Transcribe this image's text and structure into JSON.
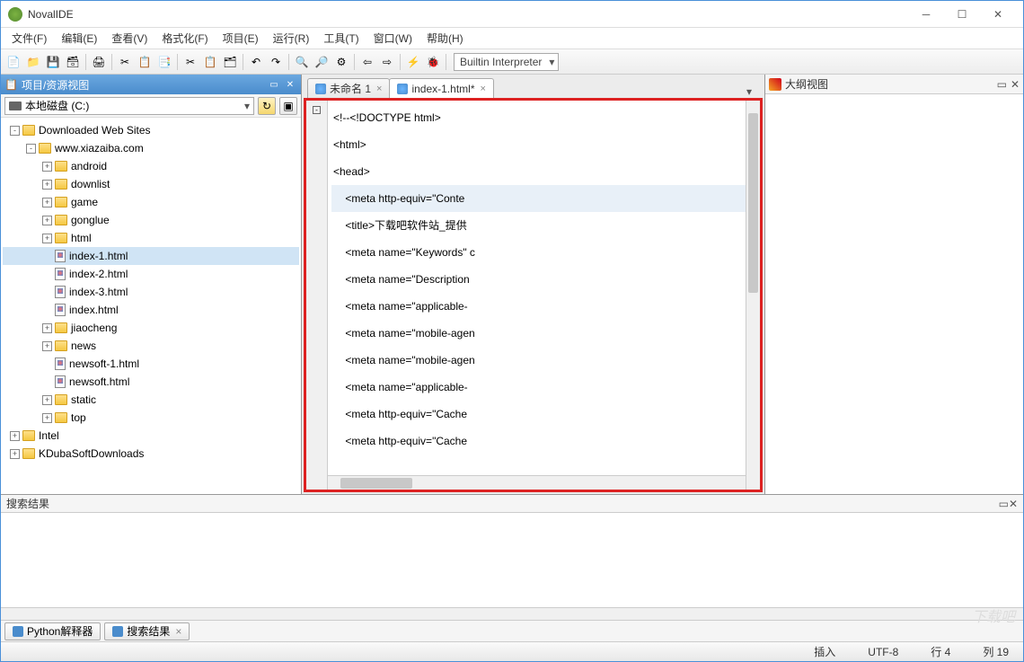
{
  "window": {
    "title": "NovalIDE"
  },
  "menus": [
    "文件(F)",
    "编辑(E)",
    "查看(V)",
    "格式化(F)",
    "项目(E)",
    "运行(R)",
    "工具(T)",
    "窗口(W)",
    "帮助(H)"
  ],
  "interpreter": "Builtin Interpreter",
  "leftPanel": {
    "title": "项目/资源视图",
    "drive": "本地磁盘 (C:)"
  },
  "tree": [
    {
      "indent": 0,
      "exp": "-",
      "icon": "fld",
      "label": "Downloaded Web Sites"
    },
    {
      "indent": 1,
      "exp": "-",
      "icon": "fld",
      "label": "www.xiazaiba.com"
    },
    {
      "indent": 2,
      "exp": "+",
      "icon": "fld",
      "label": "android"
    },
    {
      "indent": 2,
      "exp": "+",
      "icon": "fld",
      "label": "downlist"
    },
    {
      "indent": 2,
      "exp": "+",
      "icon": "fld",
      "label": "game"
    },
    {
      "indent": 2,
      "exp": "+",
      "icon": "fld",
      "label": "gonglue"
    },
    {
      "indent": 2,
      "exp": "+",
      "icon": "fld",
      "label": "html"
    },
    {
      "indent": 2,
      "exp": " ",
      "icon": "fil",
      "label": "index-1.html",
      "sel": true
    },
    {
      "indent": 2,
      "exp": " ",
      "icon": "fil",
      "label": "index-2.html"
    },
    {
      "indent": 2,
      "exp": " ",
      "icon": "fil",
      "label": "index-3.html"
    },
    {
      "indent": 2,
      "exp": " ",
      "icon": "fil",
      "label": "index.html"
    },
    {
      "indent": 2,
      "exp": "+",
      "icon": "fld",
      "label": "jiaocheng"
    },
    {
      "indent": 2,
      "exp": "+",
      "icon": "fld",
      "label": "news"
    },
    {
      "indent": 2,
      "exp": " ",
      "icon": "fil",
      "label": "newsoft-1.html"
    },
    {
      "indent": 2,
      "exp": " ",
      "icon": "fil",
      "label": "newsoft.html"
    },
    {
      "indent": 2,
      "exp": "+",
      "icon": "fld",
      "label": "static"
    },
    {
      "indent": 2,
      "exp": "+",
      "icon": "fld",
      "label": "top"
    },
    {
      "indent": 0,
      "exp": "+",
      "icon": "fld",
      "label": "Intel"
    },
    {
      "indent": 0,
      "exp": "+",
      "icon": "fld",
      "label": "KDubaSoftDownloads"
    }
  ],
  "tabs": [
    {
      "label": "未命名 1",
      "active": false
    },
    {
      "label": "index-1.html*",
      "active": true
    }
  ],
  "code": [
    {
      "text": "<!--<!DOCTYPE html>",
      "hl": false
    },
    {
      "text": "<html>",
      "hl": false
    },
    {
      "text": "<head>",
      "hl": false
    },
    {
      "text": "    <meta http-equiv=\"Conte",
      "hl": true
    },
    {
      "text": "    <title>下载吧软件站_提供",
      "hl": false
    },
    {
      "text": "    <meta name=\"Keywords\" c",
      "hl": false
    },
    {
      "text": "    <meta name=\"Description",
      "hl": false
    },
    {
      "text": "    <meta name=\"applicable-",
      "hl": false
    },
    {
      "text": "    <meta name=\"mobile-agen",
      "hl": false
    },
    {
      "text": "    <meta name=\"mobile-agen",
      "hl": false
    },
    {
      "text": "    <meta name=\"applicable-",
      "hl": false
    },
    {
      "text": "    <meta http-equiv=\"Cache",
      "hl": false
    },
    {
      "text": "    <meta http-equiv=\"Cache",
      "hl": false
    }
  ],
  "rightPanel": {
    "title": "大纲视图"
  },
  "bottomPanel": {
    "title": "搜索结果"
  },
  "bottomTabs": [
    {
      "label": "Python解释器",
      "icon": "py"
    },
    {
      "label": "搜索结果",
      "icon": "search",
      "close": true
    }
  ],
  "status": {
    "insert": "插入",
    "encoding": "UTF-8",
    "line": "行 4",
    "col": "列 19"
  },
  "toolbarIcons": [
    "new-file-icon",
    "open-icon",
    "save-icon",
    "save-all-icon",
    "print-icon",
    "cut-icon",
    "copy-icon",
    "paste-icon",
    "scissors-icon",
    "clipboard-icon",
    "stack-icon",
    "undo-icon",
    "redo-icon",
    "find-icon",
    "zoom-icon",
    "gear-icon",
    "arrow-left-icon",
    "arrow-right-icon",
    "run-icon",
    "debug-icon"
  ],
  "toolbarGlyphs": [
    "📄",
    "📁",
    "💾",
    "🗃",
    "🖨",
    "✂",
    "📋",
    "📑",
    "✂",
    "📋",
    "🗂",
    "↶",
    "↷",
    "🔍",
    "🔎",
    "⚙",
    "⇦",
    "⇨",
    "⚡",
    "🐞"
  ]
}
